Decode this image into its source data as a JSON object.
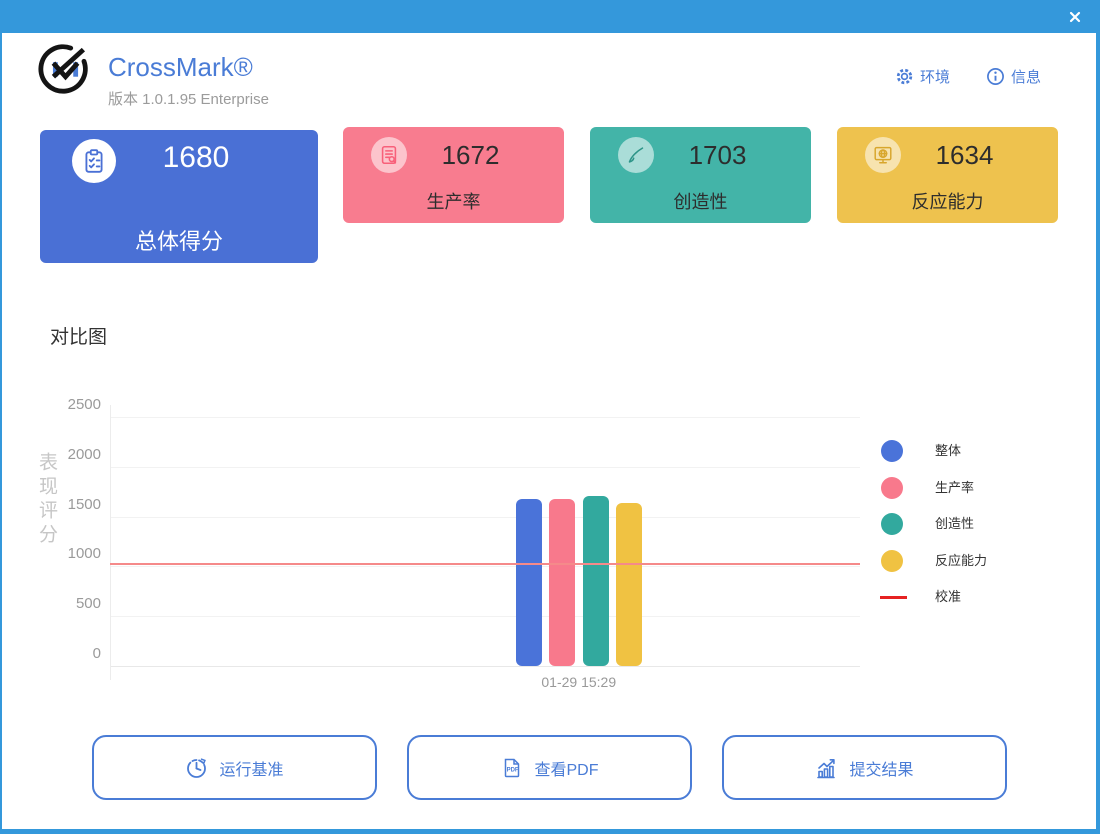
{
  "window": {
    "close_icon": "close-icon"
  },
  "header": {
    "app_name": "CrossMark®",
    "version": "版本 1.0.1.95 Enterprise",
    "env_button": "环境",
    "info_button": "信息",
    "accent_color": "#4a7cd6",
    "titlebar_color": "#3498db"
  },
  "cards": [
    {
      "score": "1680",
      "label": "总体得分",
      "color": "#4a70d5",
      "icon": "clipboard-check-icon"
    },
    {
      "score": "1672",
      "label": "生产率",
      "color": "#f87c8f",
      "icon": "document-search-icon"
    },
    {
      "score": "1703",
      "label": "创造性",
      "color": "#43b4a8",
      "icon": "paintbrush-icon"
    },
    {
      "score": "1634",
      "label": "反应能力",
      "color": "#eec24e",
      "icon": "monitor-globe-icon"
    }
  ],
  "chart_data": {
    "type": "bar",
    "title": "对比图",
    "ylabel": "表现评分",
    "categories": [
      "01-29 15:29"
    ],
    "series": [
      {
        "name": "整体",
        "color": "#4a73d9",
        "values": [
          1680
        ]
      },
      {
        "name": "生产率",
        "color": "#f8798c",
        "values": [
          1672
        ]
      },
      {
        "name": "创造性",
        "color": "#32a99e",
        "values": [
          1703
        ]
      },
      {
        "name": "反应能力",
        "color": "#f0c242",
        "values": [
          1634
        ]
      }
    ],
    "reference_line": {
      "name": "校准",
      "value": 1000,
      "color": "#f58a8a",
      "legend_color": "#e62222"
    },
    "ylim": [
      0,
      2500
    ],
    "yticks": [
      0,
      500,
      1000,
      1500,
      2000,
      2500
    ],
    "grid": true,
    "legend_position": "right"
  },
  "buttons": [
    {
      "label": "运行基准",
      "icon": "clock-icon"
    },
    {
      "label": "查看PDF",
      "icon": "pdf-icon"
    },
    {
      "label": "提交结果",
      "icon": "chart-up-icon"
    }
  ]
}
